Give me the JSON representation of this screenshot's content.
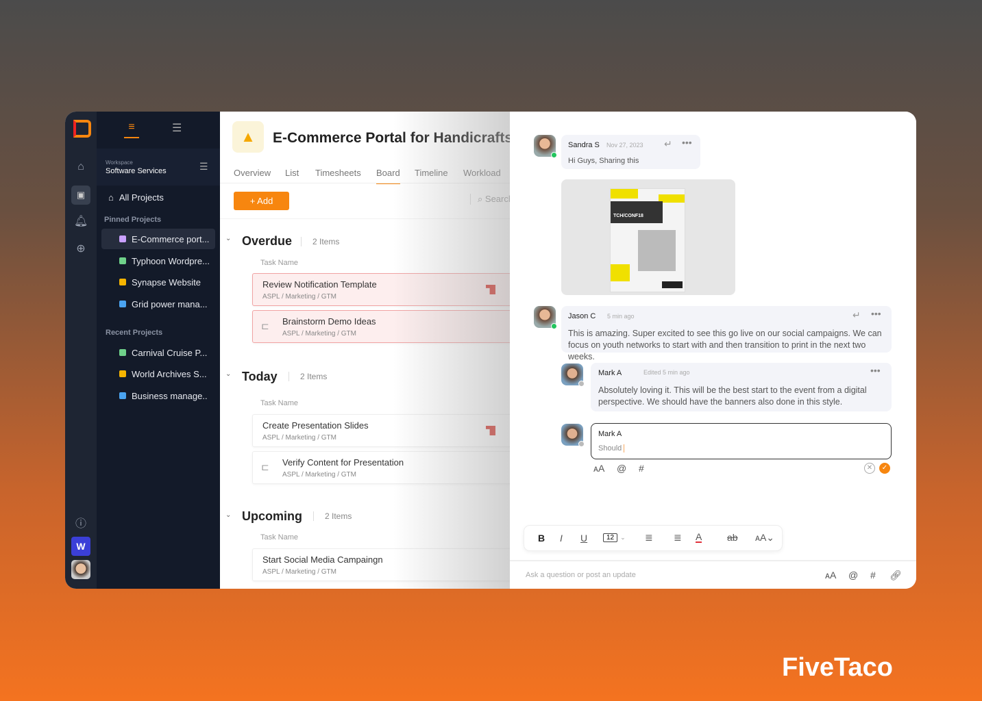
{
  "brand": "FiveTaco",
  "rail": {
    "icons": [
      "home-icon",
      "briefcase-icon",
      "bell-icon",
      "plus-circle-icon",
      "help-icon"
    ],
    "workspace_badge": "W"
  },
  "sidebar": {
    "workspace_label": "Workspace",
    "workspace_name": "Software Services",
    "all_projects": "All Projects",
    "pinned_heading": "Pinned Projects",
    "recent_heading": "Recent Projects",
    "pinned": [
      {
        "label": "E-Commerce port...",
        "color": "#c9a0ff"
      },
      {
        "label": "Typhoon Wordpre...",
        "color": "#6fd18a"
      },
      {
        "label": "Synapse Website",
        "color": "#f5b400"
      },
      {
        "label": "Grid power mana...",
        "color": "#4aa3f0"
      }
    ],
    "recent": [
      {
        "label": "Carnival Cruise P...",
        "color": "#6fd18a"
      },
      {
        "label": "World Archives S...",
        "color": "#f5b400"
      },
      {
        "label": "Business manage..",
        "color": "#4aa3f0"
      }
    ]
  },
  "project": {
    "title": "E-Commerce Portal for Handicrafts",
    "tabs": [
      "Overview",
      "List",
      "Timesheets",
      "Board",
      "Timeline",
      "Workload"
    ],
    "active_tab": "Board",
    "add_label": "+ Add",
    "search_placeholder": "Search",
    "task_name_header": "Task Name",
    "sections": [
      {
        "title": "Overdue",
        "count": "2 Items",
        "tasks": [
          {
            "title": "Review Notification Template",
            "path": "ASPL / Marketing / GTM"
          },
          {
            "title": "Brainstorm Demo Ideas",
            "path": "ASPL / Marketing / GTM"
          }
        ]
      },
      {
        "title": "Today",
        "count": "2 Items",
        "tasks": [
          {
            "title": "Create Presentation Slides",
            "path": "ASPL / Marketing / GTM"
          },
          {
            "title": "Verify Content for Presentation",
            "path": "ASPL / Marketing / GTM"
          }
        ]
      },
      {
        "title": "Upcoming",
        "count": "2 Items",
        "tasks": [
          {
            "title": "Start Social Media Campaingn",
            "path": "ASPL / Marketing / GTM"
          }
        ]
      }
    ]
  },
  "chat": {
    "m1": {
      "name": "Sandra S",
      "time": "Nov 27, 2023",
      "text": "Hi Guys, Sharing this",
      "image_text": "TCH/CONF18"
    },
    "m2": {
      "name": "Jason C",
      "time": "5 min ago",
      "text": "This is amazing. Super excited to see this go live on our social campaigns. We can focus on youth networks to start with and then transition to print in the next two weeks."
    },
    "m3": {
      "name": "Mark A",
      "time": "Edited 5 min ago",
      "text": "Absolutely loving it. This will be the best start to the event from a digital perspective. We should have the banners also done in this style."
    },
    "reply": {
      "name": "Mark A",
      "value": "Should"
    },
    "toolbar": {
      "font_size": "12"
    },
    "composer_placeholder": "Ask a question or post an update"
  },
  "colors": {
    "accent": "#f7860f",
    "sidebar": "#131a29",
    "overdue_border": "#f1a3a3"
  }
}
